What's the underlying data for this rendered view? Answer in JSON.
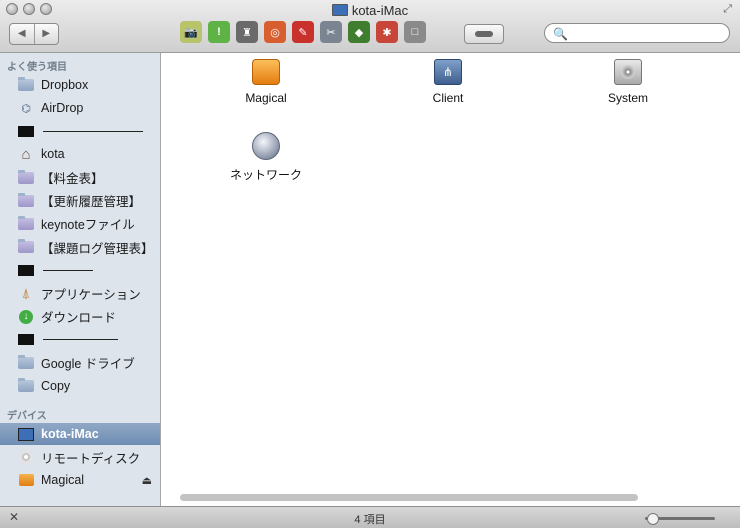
{
  "window": {
    "title": "kota-iMac",
    "fullscreen_glyph": "⤢"
  },
  "nav": {
    "back": "◀",
    "forward": "▶"
  },
  "search": {
    "glyph": "🔍",
    "value": "",
    "placeholder": ""
  },
  "toolbar_icons": [
    {
      "name": "photo-tool-icon",
      "glyph": "📷",
      "color": "#b9c36a"
    },
    {
      "name": "green-exclaim-icon",
      "glyph": "!",
      "color": "#5fb246"
    },
    {
      "name": "sweeper-icon",
      "glyph": "♜",
      "color": "#6a6a6a"
    },
    {
      "name": "red-disc-icon",
      "glyph": "◎",
      "color": "#d95e2f"
    },
    {
      "name": "marker-icon",
      "glyph": "✎",
      "color": "#c9312d"
    },
    {
      "name": "screenshot-icon",
      "glyph": "✂",
      "color": "#7b8591"
    },
    {
      "name": "green-card-icon",
      "glyph": "◆",
      "color": "#3f7d2f"
    },
    {
      "name": "robot-icon",
      "glyph": "✱",
      "color": "#c8453a"
    },
    {
      "name": "square-button-icon",
      "glyph": "□",
      "color": "#8a8a8a"
    }
  ],
  "sidebar": {
    "favorites_header": "よく使う項目",
    "devices_header": "デバイス",
    "favorites": [
      {
        "label": "Dropbox",
        "type": "folder"
      },
      {
        "label": "AirDrop",
        "type": "airdrop"
      },
      {
        "label": "",
        "type": "separator",
        "rule_width": 100
      },
      {
        "label": "kota",
        "type": "home"
      },
      {
        "label": "【料金表】",
        "type": "folder-purple"
      },
      {
        "label": "【更新履歴管理】",
        "type": "folder-purple"
      },
      {
        "label": "keynoteファイル",
        "type": "folder-purple"
      },
      {
        "label": "【課題ログ管理表】",
        "type": "folder-purple"
      },
      {
        "label": "",
        "type": "separator",
        "rule_width": 50
      },
      {
        "label": "アプリケーション",
        "type": "apps"
      },
      {
        "label": "ダウンロード",
        "type": "download"
      },
      {
        "label": "",
        "type": "separator",
        "rule_width": 75
      },
      {
        "label": "Google ドライブ",
        "type": "folder"
      },
      {
        "label": "Copy",
        "type": "folder"
      }
    ],
    "devices": [
      {
        "label": "kota-iMac",
        "type": "imac",
        "selected": true
      },
      {
        "label": "リモートディスク",
        "type": "disc"
      },
      {
        "label": "Magical",
        "type": "drive-orange",
        "eject": "⏏"
      }
    ]
  },
  "content": {
    "items": [
      {
        "label": "Magical",
        "type": "drive-orange"
      },
      {
        "label": "Client",
        "type": "network-drive"
      },
      {
        "label": "System",
        "type": "hdd"
      },
      {
        "label": "ネットワーク",
        "type": "network"
      }
    ]
  },
  "status": {
    "count": "4 項目",
    "pin_glyph": "✕"
  },
  "colors": {
    "selection": "#7c97bb",
    "sidebar_bg": "#dde4ec"
  }
}
